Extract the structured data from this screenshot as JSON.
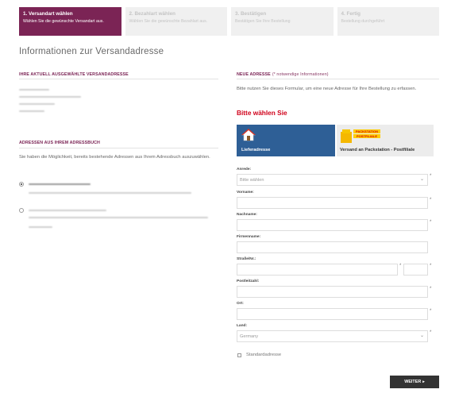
{
  "steps": [
    {
      "title": "1. Versandart wählen",
      "desc": "Wählen Sie die gewünschte Versandart aus."
    },
    {
      "title": "2. Bezahlart wählen",
      "desc": "Wählen Sie die gewünschte Bezahlart aus."
    },
    {
      "title": "3. Bestätigen",
      "desc": "Bestätigen Sie Ihre Bestellung"
    },
    {
      "title": "4. Fertig",
      "desc": "Bestellung durchgeführt"
    }
  ],
  "page_title": "Informationen zur Versandadresse",
  "current_address": {
    "heading": "IHRE AKTUELL AUSGEWÄHLTE VERSANDADRESSE"
  },
  "address_book": {
    "heading": "ADRESSEN AUS IHREM ADRESSBUCH",
    "intro": "Sie haben die Möglichkeit, bereits bestehende Adressen aus Ihrem Adressbuch auszuwählen."
  },
  "new_address": {
    "heading": "NEUE ADRESSE",
    "note": "(* notwendige Informationen)",
    "intro": "Bitte nutzen Sie dieses Formular, um eine neue Adresse für Ihre Bestellung zu erfassen.",
    "choose": "Bitte wählen Sie",
    "options": {
      "lief": "Lieferadresse",
      "pack": "Versand an Packstation - Postfiliale"
    },
    "packstation_logo_top": "PACKSTATION",
    "packstation_logo_bottom": "POSTFILIALE"
  },
  "form": {
    "anrede_label": "Anrede:",
    "anrede_value": "Bitte wählen",
    "vorname_label": "Vorname:",
    "nachname_label": "Nachname:",
    "firma_label": "Firmenname:",
    "strasse_label": "Straße/Nr.:",
    "plz_label": "Postleitzahl:",
    "ort_label": "Ort:",
    "land_label": "Land:",
    "land_value": "Germany",
    "required_mark": "*",
    "standard_label": "Standardadresse"
  },
  "next_button": "WEITER",
  "next_arrow": "▸",
  "select_arrow": "⌄",
  "colors": {
    "accent": "#7b2455",
    "lief_bg": "#2e5f96",
    "alert": "#d0021b",
    "button": "#333333"
  },
  "icons": [
    "house-icon",
    "packstation-logo",
    "chevron-down-icon",
    "arrow-right-icon"
  ]
}
